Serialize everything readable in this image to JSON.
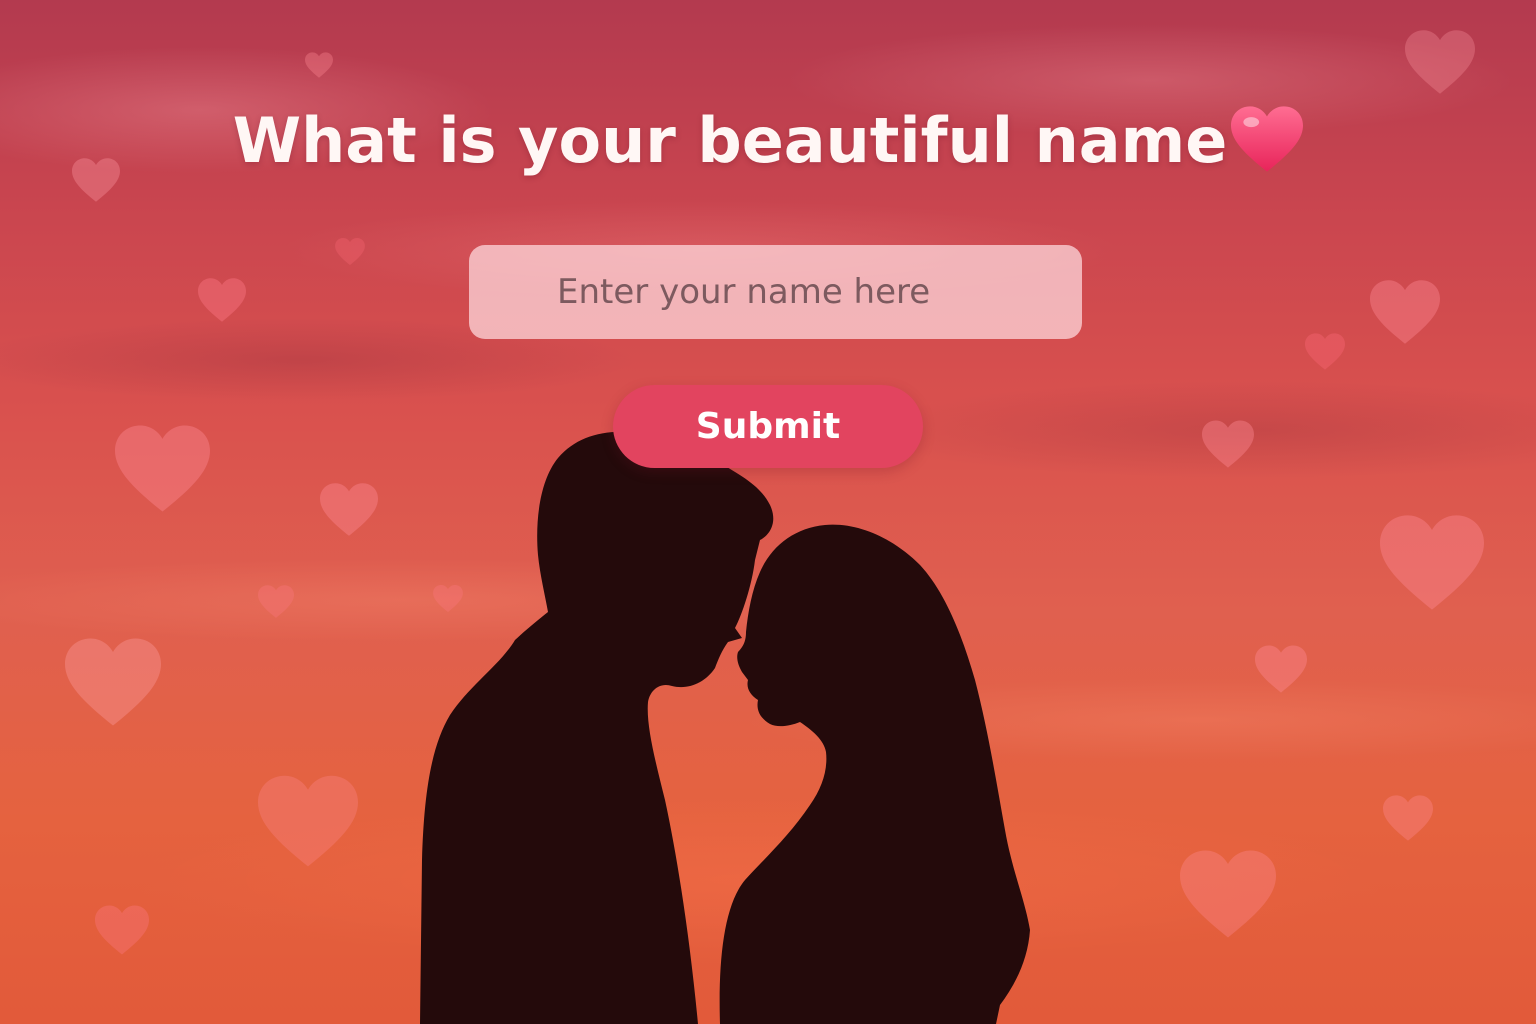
{
  "page": {
    "title": "What is your beautiful name",
    "title_emoji": "heart-emoji"
  },
  "form": {
    "name_placeholder": "Enter your name here",
    "name_value": "",
    "submit_label": "Submit"
  },
  "colors": {
    "accent": "#e2445f",
    "title_text": "#fff7f5",
    "heart_emoji": "#f23a6a"
  }
}
